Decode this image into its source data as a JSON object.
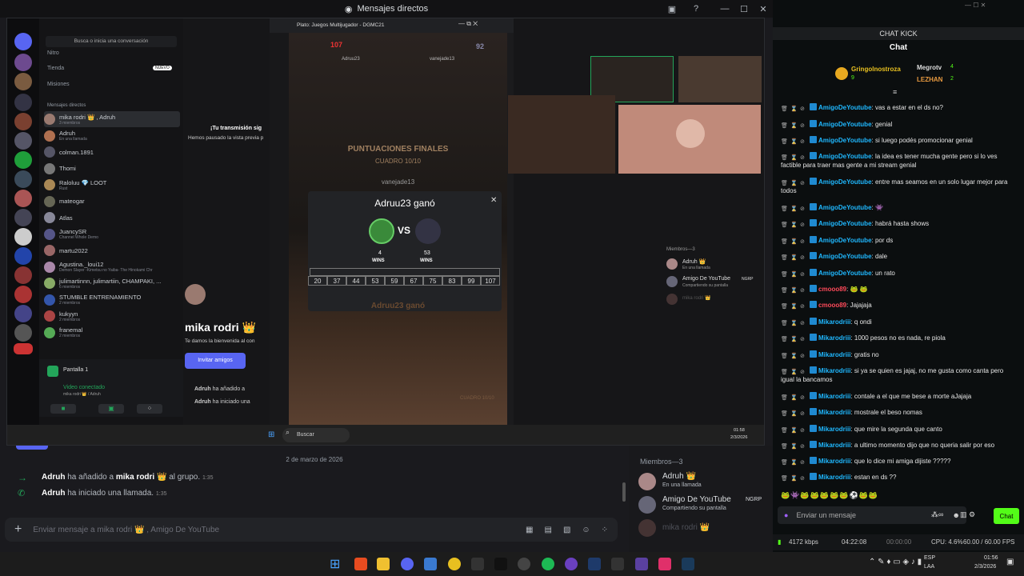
{
  "discord": {
    "window_title": "Mensajes directos",
    "search_placeholder": "Busca o inicia una conversación",
    "nav": {
      "nitro": "Nitro",
      "tienda": "Tienda",
      "nuevo": "NUEVO",
      "misiones": "Misiones",
      "dm_header": "Mensajes directos"
    },
    "dms": [
      {
        "name": "mika rodri 👑 , Adruh",
        "sub": "3 miembros"
      },
      {
        "name": "Adruh",
        "sub": "En una llamada"
      },
      {
        "name": "colman.1891",
        "sub": ""
      },
      {
        "name": "Thomi",
        "sub": ""
      },
      {
        "name": "Raloluu 💎 LOOT",
        "sub": "Rust"
      },
      {
        "name": "mateogar",
        "sub": ""
      },
      {
        "name": "Atlas",
        "sub": ""
      },
      {
        "name": "JuancySR",
        "sub": "Channel Whole Demo"
      },
      {
        "name": "martu2022",
        "sub": ""
      },
      {
        "name": "Agustina._loui12",
        "sub": "Demon Slayer -Kimetsu no Yaiba- The Hinokami Chr"
      },
      {
        "name": "julimartinnn, julimartiin, CHAMPAKI, ...",
        "sub": "6 miembros"
      },
      {
        "name": "STUMBLE ENTRENAMIENTO",
        "sub": "2 miembros"
      },
      {
        "name": "kukyyn",
        "sub": "2 miembros"
      },
      {
        "name": "franemal",
        "sub": "2 miembros"
      }
    ],
    "voice": {
      "channel": "Pantalla 1",
      "status": "Video conectado",
      "sub": "mika rodri 👑 / Adruh"
    },
    "stream_notice": {
      "title": "¡Tu transmisión sig",
      "body": "Hemos pausado la vista previa p"
    },
    "dm_profile": {
      "name": "mika rodri 👑",
      "welcome": "Te damos la bienvenida al con",
      "invite": "Invitar amigos"
    },
    "inner_log": [
      {
        "user": "Adruh",
        "text": "ha añadido a"
      },
      {
        "user": "Adruh",
        "text": "ha iniciado una"
      }
    ],
    "inner_members": {
      "header": "Miembros—3",
      "m1": "Adruh 👑",
      "m1s": "En una llamada",
      "m2": "Amigo De YouTube",
      "m2tag": "NGRP",
      "m2s": "Compartiendo su pantalla",
      "m3": "mika rodri 👑"
    },
    "game": {
      "title": "Plato: Juegos Multijugador - DGMC21",
      "final": "PUNTUACIONES FINALES",
      "frame": "CUADRO 10/10",
      "player_top": "vanejade13",
      "winner": "Adruu23 ganó",
      "vs": "VS",
      "wins_left": "4",
      "wins_right": "53",
      "wins_label": "WINS",
      "scores": [
        "20",
        "37",
        "44",
        "53",
        "59",
        "67",
        "75",
        "83",
        "99",
        "107"
      ],
      "winner_bottom": "Adruu23 ganó",
      "footer": "CUADRO 10/10",
      "top_left_score": "107",
      "top_right_score": "92",
      "top_left_name": "Adruu23",
      "top_right_name": "vanejade13"
    },
    "date_divider": "2 de marzo de 2026",
    "log": [
      {
        "user": "Adruh",
        "pre": "ha añadido a",
        "target": "mika rodri 👑",
        "post": "al grupo.",
        "time": "1:35"
      },
      {
        "user": "Adruh",
        "pre": "ha iniciado una llamada.",
        "target": "",
        "post": "",
        "time": "1:35"
      }
    ],
    "members": {
      "header": "Miembros—3",
      "m1": "Adruh 👑",
      "m1s": "En una llamada",
      "m2": "Amigo De YouTube",
      "m2tag": "NGRP",
      "m2s": "Compartiendo su pantalla",
      "m3": "mika rodri 👑"
    },
    "message_placeholder": "Enviar mensaje a mika rodri 👑 , Amigo De YouTube",
    "inner_taskbar_search": "Buscar",
    "inner_time": "01:58",
    "inner_date": "2/3/2026"
  },
  "kick": {
    "window_title": "CHAT KICK",
    "header": "Chat",
    "top_gifters": [
      {
        "name": "Gringolnostroza",
        "count": "9"
      },
      {
        "name": "Megrotv",
        "count": "4"
      },
      {
        "name": "LEZHAN",
        "count": "2"
      }
    ],
    "messages": [
      {
        "user": "AmigoDeYoutube",
        "color": "#1fb8ff",
        "text": "vas a estar en el ds no?"
      },
      {
        "user": "AmigoDeYoutube",
        "color": "#1fb8ff",
        "text": "genial"
      },
      {
        "user": "AmigoDeYoutube",
        "color": "#1fb8ff",
        "text": "si luego podés promocionar genial"
      },
      {
        "user": "AmigoDeYoutube",
        "color": "#1fb8ff",
        "text": "la idea es tener mucha gente pero si lo ves factible para traer mas gente a mi stream genial"
      },
      {
        "user": "AmigoDeYoutube",
        "color": "#1fb8ff",
        "text": "entre mas seamos en un solo lugar mejor para todos"
      },
      {
        "user": "AmigoDeYoutube",
        "color": "#1fb8ff",
        "text": "👾"
      },
      {
        "user": "AmigoDeYoutube",
        "color": "#1fb8ff",
        "text": "habrá hasta shows"
      },
      {
        "user": "AmigoDeYoutube",
        "color": "#1fb8ff",
        "text": "por ds"
      },
      {
        "user": "AmigoDeYoutube",
        "color": "#1fb8ff",
        "text": "dale"
      },
      {
        "user": "AmigoDeYoutube",
        "color": "#1fb8ff",
        "text": "un rato"
      },
      {
        "user": "cmooo89",
        "color": "#ff4a5a",
        "text": "🐸 🐸"
      },
      {
        "user": "cmooo89",
        "color": "#ff4a5a",
        "text": "Jajajaja"
      },
      {
        "user": "Mikarodriii",
        "color": "#1fb8ff",
        "text": "q ondi"
      },
      {
        "user": "Mikarodriii",
        "color": "#1fb8ff",
        "text": "1000 pesos no es nada, re piola"
      },
      {
        "user": "Mikarodriii",
        "color": "#1fb8ff",
        "text": "gratis no"
      },
      {
        "user": "Mikarodriii",
        "color": "#1fb8ff",
        "text": "si ya se quien es jajaj, no me gusta como canta pero igual la bancamos"
      },
      {
        "user": "Mikarodriii",
        "color": "#1fb8ff",
        "text": "contale a el que me bese a morte aJajaja"
      },
      {
        "user": "Mikarodriii",
        "color": "#1fb8ff",
        "text": "mostrale el beso nomas"
      },
      {
        "user": "Mikarodriii",
        "color": "#1fb8ff",
        "text": "que mire la segunda que canto"
      },
      {
        "user": "Mikarodriii",
        "color": "#1fb8ff",
        "text": "a ultimo momento dijo que no queria salir por eso"
      },
      {
        "user": "Mikarodriii",
        "color": "#1fb8ff",
        "text": "que lo dice mi amiga dijiste ?????"
      },
      {
        "user": "Mikarodriii",
        "color": "#1fb8ff",
        "text": "estan en ds ??"
      }
    ],
    "input_placeholder": "Enviar un mensaje",
    "chat_button": "Chat",
    "status": {
      "bitrate": "4172 kbps",
      "time1": "04:22:08",
      "time2": "00:00:00",
      "cpu": "CPU: 4.6%",
      "fps": "60.00 / 60.00 FPS"
    }
  },
  "taskbar": {
    "lang": "ESP",
    "lang2": "LAA",
    "time": "01:56",
    "date": "2/3/2026"
  },
  "colors": {
    "kick_green": "#53fc18",
    "discord_blurple": "#5865f2",
    "online": "#23a55a"
  }
}
